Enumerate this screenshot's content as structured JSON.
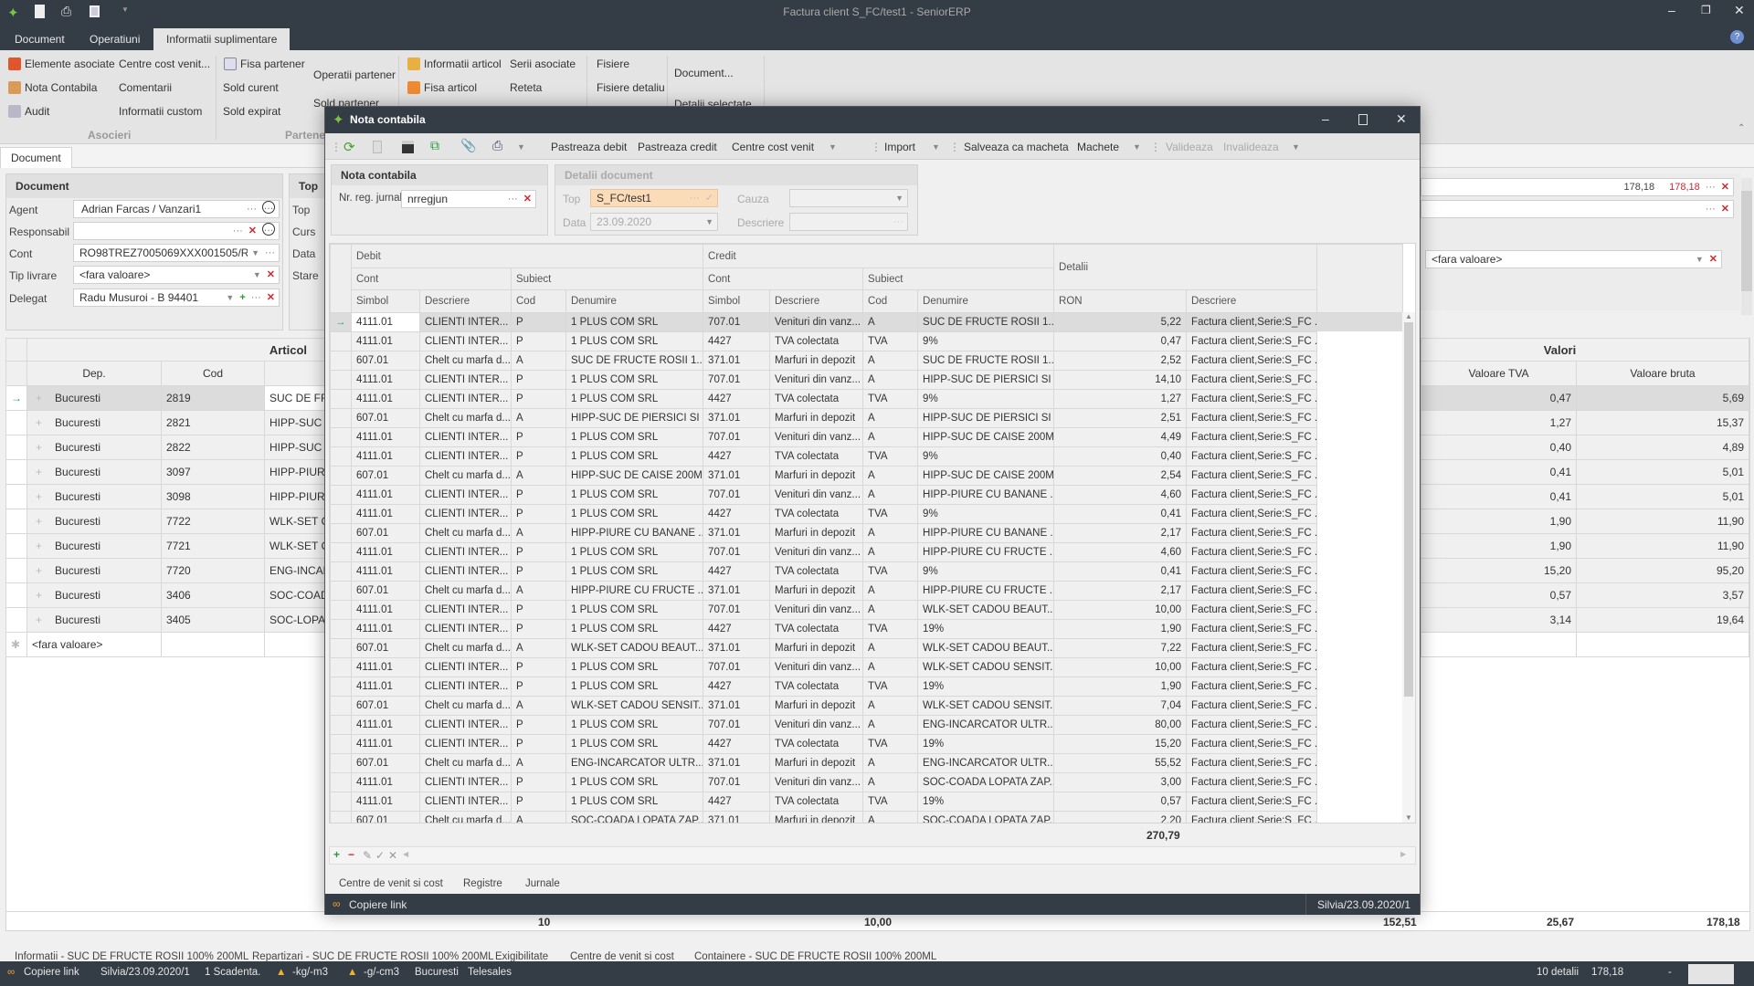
{
  "app": {
    "title": "Factura client S_FC/test1 - SeniorERP",
    "accent": "#7dc242",
    "dark": "#343c46"
  },
  "ribbon": {
    "tabs": [
      "Document",
      "Operatiuni",
      "Informatii suplimentare"
    ],
    "asocieri": {
      "items": [
        "Elemente asociate",
        "Nota Contabila",
        "Audit",
        "Centre cost venit...",
        "Comentarii",
        "Informatii custom"
      ],
      "label": "Asocieri"
    },
    "partener": {
      "items": [
        "Fisa partener",
        "Sold curent",
        "Sold expirat",
        "Operatii partener",
        "Sold partener"
      ],
      "label": "Partener"
    },
    "articol": {
      "items": [
        "Informatii articol",
        "Fisa articol",
        "Serii asociate",
        "Reteta"
      ]
    },
    "fisiere": {
      "items": [
        "Fisiere",
        "Fisiere detaliu"
      ]
    },
    "document": {
      "items": [
        "Document...",
        "Detalii selectate"
      ]
    }
  },
  "doc_tab": "Document",
  "document_group": {
    "title": "Document",
    "fields": [
      {
        "label": "Agent",
        "value": "Adrian Farcas / Vanzari1"
      },
      {
        "label": "Responsabil",
        "value": ""
      },
      {
        "label": "Cont",
        "value": "RO98TREZ7005069XXX001505/RO..."
      },
      {
        "label": "Tip livrare",
        "value": "<fara valoare>"
      },
      {
        "label": "Delegat",
        "value": "Radu Musuroi - B 94401"
      }
    ]
  },
  "top_group": {
    "title": "Top",
    "labels": [
      "Top",
      "Curs",
      "Data",
      "Stare"
    ]
  },
  "articol_grid": {
    "title": "Articol",
    "columns": [
      "Dep.",
      "Cod"
    ],
    "rows": [
      [
        "Bucuresti",
        "2819",
        "SUC DE FRUCTE ROSII 100% 200ML"
      ],
      [
        "Bucuresti",
        "2821",
        "HIPP-SUC DE PIERSICI SI"
      ],
      [
        "Bucuresti",
        "2822",
        "HIPP-SUC DE CAISE 200ML"
      ],
      [
        "Bucuresti",
        "3097",
        "HIPP-PIURE"
      ],
      [
        "Bucuresti",
        "3098",
        "HIPP-PIURE"
      ],
      [
        "Bucuresti",
        "7722",
        "WLK-SET CADOU"
      ],
      [
        "Bucuresti",
        "7721",
        "WLK-SET CADOU"
      ],
      [
        "Bucuresti",
        "7720",
        "ENG-INCARCATOR"
      ],
      [
        "Bucuresti",
        "3406",
        "SOC-COADA"
      ],
      [
        "Bucuresti",
        "3405",
        "SOC-LOPATA"
      ]
    ],
    "new_row": "<fara valoare>"
  },
  "right_panel": {
    "total1": "178,18",
    "total1_red": "178,18",
    "dropdown": "<fara valoare>",
    "title": "Valori",
    "columns": [
      "Valoare TVA",
      "Valoare bruta"
    ],
    "rows": [
      [
        "0,47",
        "5,69"
      ],
      [
        "1,27",
        "15,37"
      ],
      [
        "0,40",
        "4,89"
      ],
      [
        "0,41",
        "5,01"
      ],
      [
        "0,41",
        "5,01"
      ],
      [
        "1,90",
        "11,90"
      ],
      [
        "1,90",
        "11,90"
      ],
      [
        "15,20",
        "95,20"
      ],
      [
        "0,57",
        "3,57"
      ],
      [
        "3,14",
        "19,64"
      ]
    ]
  },
  "totals": {
    "count": "10",
    "qty": "10,00",
    "net": "152,51",
    "tva": "25,67",
    "gross": "178,18"
  },
  "bottom_tabs": [
    "Informatii - SUC DE FRUCTE ROSII 100% 200ML",
    "Repartizari - SUC DE FRUCTE ROSII 100% 200ML",
    "Exigibilitate",
    "Centre de venit si cost",
    "Containere - SUC DE FRUCTE ROSII 100% 200ML"
  ],
  "status": {
    "copy": "Copiere link",
    "user": "Silvia/23.09.2020/1",
    "scad": "1 Scadenta.",
    "w1": "-kg/-m3",
    "w2": "-g/-cm3",
    "city": "Bucuresti",
    "channel": "Telesales",
    "details": "10 detalii",
    "sum": "178,18",
    "dash": "-"
  },
  "dialog": {
    "title": "Nota contabila",
    "toolbar": {
      "pd": "Pastreaza debit",
      "pc": "Pastreaza credit",
      "ccv": "Centre cost venit",
      "imp": "Import",
      "scm": "Salveaza ca macheta",
      "mach": "Machete",
      "val": "Valideaza",
      "inval": "Invalideaza"
    },
    "nota": {
      "title": "Nota contabila",
      "label": "Nr. reg. jurnal",
      "value": "nrregjun"
    },
    "detalii": {
      "title": "Detalii document",
      "top_label": "Top",
      "top_value": "S_FC/test1",
      "cauza_label": "Cauza",
      "data_label": "Data",
      "data_value": "23.09.2020",
      "descriere_label": "Descriere"
    },
    "grid": {
      "h1": [
        "Debit",
        "Credit",
        "Detalii"
      ],
      "h2": [
        "Cont",
        "Subiect",
        "Cont",
        "Subiect"
      ],
      "h3": [
        "Simbol",
        "Descriere",
        "Cod",
        "Denumire",
        "Simbol",
        "Descriere",
        "Cod",
        "Denumire",
        "RON",
        "Descriere"
      ],
      "rows": [
        [
          "4111.01",
          "CLIENTI INTER...",
          "P",
          "1 PLUS COM SRL",
          "707.01",
          "Venituri din vanz...",
          "A",
          "SUC DE FRUCTE ROSII 1...",
          "5,22",
          "Factura client,Serie:S_FC ..."
        ],
        [
          "4111.01",
          "CLIENTI INTER...",
          "P",
          "1 PLUS COM SRL",
          "4427",
          "TVA colectata",
          "TVA",
          "9%",
          "0,47",
          "Factura client,Serie:S_FC ..."
        ],
        [
          "607.01",
          "Chelt cu marfa d...",
          "A",
          "SUC DE FRUCTE ROSII 1...",
          "371.01",
          "Marfuri in depozit",
          "A",
          "SUC DE FRUCTE ROSII 1...",
          "2,52",
          "Factura client,Serie:S_FC ..."
        ],
        [
          "4111.01",
          "CLIENTI INTER...",
          "P",
          "1 PLUS COM SRL",
          "707.01",
          "Venituri din vanz...",
          "A",
          "HIPP-SUC DE PIERSICI SI ...",
          "14,10",
          "Factura client,Serie:S_FC ..."
        ],
        [
          "4111.01",
          "CLIENTI INTER...",
          "P",
          "1 PLUS COM SRL",
          "4427",
          "TVA colectata",
          "TVA",
          "9%",
          "1,27",
          "Factura client,Serie:S_FC ..."
        ],
        [
          "607.01",
          "Chelt cu marfa d...",
          "A",
          "HIPP-SUC DE PIERSICI SI ...",
          "371.01",
          "Marfuri in depozit",
          "A",
          "HIPP-SUC DE PIERSICI SI ...",
          "2,51",
          "Factura client,Serie:S_FC ..."
        ],
        [
          "4111.01",
          "CLIENTI INTER...",
          "P",
          "1 PLUS COM SRL",
          "707.01",
          "Venituri din vanz...",
          "A",
          "HIPP-SUC DE CAISE 200ML",
          "4,49",
          "Factura client,Serie:S_FC ..."
        ],
        [
          "4111.01",
          "CLIENTI INTER...",
          "P",
          "1 PLUS COM SRL",
          "4427",
          "TVA colectata",
          "TVA",
          "9%",
          "0,40",
          "Factura client,Serie:S_FC ..."
        ],
        [
          "607.01",
          "Chelt cu marfa d...",
          "A",
          "HIPP-SUC DE CAISE 200ML",
          "371.01",
          "Marfuri in depozit",
          "A",
          "HIPP-SUC DE CAISE 200ML",
          "2,54",
          "Factura client,Serie:S_FC ..."
        ],
        [
          "4111.01",
          "CLIENTI INTER...",
          "P",
          "1 PLUS COM SRL",
          "707.01",
          "Venituri din vanz...",
          "A",
          "HIPP-PIURE CU BANANE ...",
          "4,60",
          "Factura client,Serie:S_FC ..."
        ],
        [
          "4111.01",
          "CLIENTI INTER...",
          "P",
          "1 PLUS COM SRL",
          "4427",
          "TVA colectata",
          "TVA",
          "9%",
          "0,41",
          "Factura client,Serie:S_FC ..."
        ],
        [
          "607.01",
          "Chelt cu marfa d...",
          "A",
          "HIPP-PIURE CU BANANE ...",
          "371.01",
          "Marfuri in depozit",
          "A",
          "HIPP-PIURE CU BANANE ...",
          "2,17",
          "Factura client,Serie:S_FC ..."
        ],
        [
          "4111.01",
          "CLIENTI INTER...",
          "P",
          "1 PLUS COM SRL",
          "707.01",
          "Venituri din vanz...",
          "A",
          "HIPP-PIURE CU FRUCTE ...",
          "4,60",
          "Factura client,Serie:S_FC ..."
        ],
        [
          "4111.01",
          "CLIENTI INTER...",
          "P",
          "1 PLUS COM SRL",
          "4427",
          "TVA colectata",
          "TVA",
          "9%",
          "0,41",
          "Factura client,Serie:S_FC ..."
        ],
        [
          "607.01",
          "Chelt cu marfa d...",
          "A",
          "HIPP-PIURE CU FRUCTE ...",
          "371.01",
          "Marfuri in depozit",
          "A",
          "HIPP-PIURE CU FRUCTE ...",
          "2,17",
          "Factura client,Serie:S_FC ..."
        ],
        [
          "4111.01",
          "CLIENTI INTER...",
          "P",
          "1 PLUS COM SRL",
          "707.01",
          "Venituri din vanz...",
          "A",
          "WLK-SET CADOU BEAUT...",
          "10,00",
          "Factura client,Serie:S_FC ..."
        ],
        [
          "4111.01",
          "CLIENTI INTER...",
          "P",
          "1 PLUS COM SRL",
          "4427",
          "TVA colectata",
          "TVA",
          "19%",
          "1,90",
          "Factura client,Serie:S_FC ..."
        ],
        [
          "607.01",
          "Chelt cu marfa d...",
          "A",
          "WLK-SET CADOU BEAUT...",
          "371.01",
          "Marfuri in depozit",
          "A",
          "WLK-SET CADOU BEAUT...",
          "7,22",
          "Factura client,Serie:S_FC ..."
        ],
        [
          "4111.01",
          "CLIENTI INTER...",
          "P",
          "1 PLUS COM SRL",
          "707.01",
          "Venituri din vanz...",
          "A",
          "WLK-SET CADOU SENSIT...",
          "10,00",
          "Factura client,Serie:S_FC ..."
        ],
        [
          "4111.01",
          "CLIENTI INTER...",
          "P",
          "1 PLUS COM SRL",
          "4427",
          "TVA colectata",
          "TVA",
          "19%",
          "1,90",
          "Factura client,Serie:S_FC ..."
        ],
        [
          "607.01",
          "Chelt cu marfa d...",
          "A",
          "WLK-SET CADOU SENSIT...",
          "371.01",
          "Marfuri in depozit",
          "A",
          "WLK-SET CADOU SENSIT...",
          "7,04",
          "Factura client,Serie:S_FC ..."
        ],
        [
          "4111.01",
          "CLIENTI INTER...",
          "P",
          "1 PLUS COM SRL",
          "707.01",
          "Venituri din vanz...",
          "A",
          "ENG-INCARCATOR ULTR...",
          "80,00",
          "Factura client,Serie:S_FC ..."
        ],
        [
          "4111.01",
          "CLIENTI INTER...",
          "P",
          "1 PLUS COM SRL",
          "4427",
          "TVA colectata",
          "TVA",
          "19%",
          "15,20",
          "Factura client,Serie:S_FC ..."
        ],
        [
          "607.01",
          "Chelt cu marfa d...",
          "A",
          "ENG-INCARCATOR ULTR...",
          "371.01",
          "Marfuri in depozit",
          "A",
          "ENG-INCARCATOR ULTR...",
          "55,52",
          "Factura client,Serie:S_FC ..."
        ],
        [
          "4111.01",
          "CLIENTI INTER...",
          "P",
          "1 PLUS COM SRL",
          "707.01",
          "Venituri din vanz...",
          "A",
          "SOC-COADA LOPATA ZAP...",
          "3,00",
          "Factura client,Serie:S_FC ..."
        ],
        [
          "4111.01",
          "CLIENTI INTER...",
          "P",
          "1 PLUS COM SRL",
          "4427",
          "TVA colectata",
          "TVA",
          "19%",
          "0,57",
          "Factura client,Serie:S_FC ..."
        ],
        [
          "607.01",
          "Chelt cu marfa d...",
          "A",
          "SOC-COADA LOPATA ZAP...",
          "371.01",
          "Marfuri in depozit",
          "A",
          "SOC-COADA LOPATA ZAP...",
          "2,20",
          "Factura client,Serie:S_FC ..."
        ]
      ],
      "total": "270,79"
    },
    "tabs": [
      "Centre de venit si cost",
      "Registre",
      "Jurnale"
    ],
    "footer": {
      "copy": "Copiere link",
      "user": "Silvia/23.09.2020/1"
    }
  }
}
